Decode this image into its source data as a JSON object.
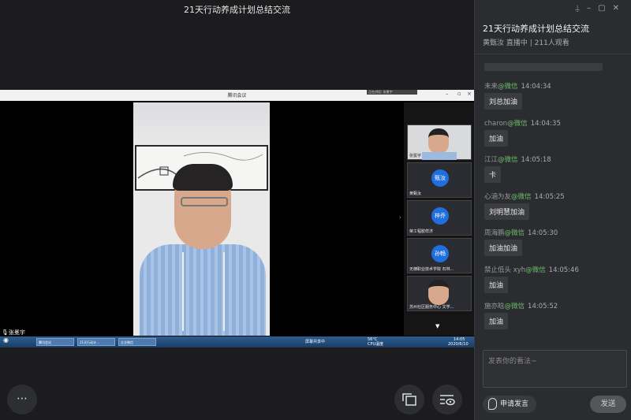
{
  "stage": {
    "title": "21天行动养成计划总结交流",
    "meeting_window_title": "腾讯会议",
    "meeting_status": "正在讲话: 张冕宇",
    "presenter": "张冕宇",
    "thumbnails": [
      {
        "label": "张冕宇",
        "avatar": ""
      },
      {
        "label": "黄甄汝",
        "avatar": "甄汝"
      },
      {
        "label": "荣工程胶样济",
        "avatar": "梓乔"
      },
      {
        "label": "无棣职业技术学院 石林...",
        "avatar": "孙畅"
      },
      {
        "label": "苏州社区服务中心 文学...",
        "avatar": ""
      }
    ],
    "taskbar": {
      "tasks": [
        "腾讯会议",
        "21天行动计...",
        "企业微信"
      ],
      "sharing_label": "屏幕共享中",
      "temperature": "56°C",
      "cpu_label": "CPU温度",
      "time": "14:05",
      "date": "2020/6/10"
    },
    "controls": {
      "more_icon": "more-icon",
      "window_icon": "window-switch-icon",
      "eye_icon": "eye-settings-icon"
    }
  },
  "panel": {
    "title": "21天行动养成计划总结交流",
    "subtitle": "黄甄汝  直播中 | 211人观看",
    "messages": [
      {
        "user": "未来",
        "source": "@微信",
        "time": "14:04:34",
        "text": "刘总加油"
      },
      {
        "user": "charon",
        "source": "@微信",
        "time": "14:04:35",
        "text": "加油"
      },
      {
        "user": "江江",
        "source": "@微信",
        "time": "14:05:18",
        "text": "卡"
      },
      {
        "user": "心涵为友",
        "source": "@微信",
        "time": "14:05:25",
        "text": "刘明慧加油"
      },
      {
        "user": "周海鹏",
        "source": "@微信",
        "time": "14:05:30",
        "text": "加油加油"
      },
      {
        "user": "禁止低头 xyh",
        "source": "@微信",
        "time": "14:05:46",
        "text": "加油"
      },
      {
        "user": "施亦晗",
        "source": "@微信",
        "time": "14:05:52",
        "text": "加油"
      }
    ],
    "input_placeholder": "发表你的看法~",
    "apply_button": "申请发言",
    "send_button": "发送",
    "window_controls": [
      "pin-icon",
      "minimize-icon",
      "maximize-icon",
      "close-icon"
    ]
  },
  "colors": {
    "accent_green": "#6cc16c",
    "panel_bg": "#2b2c2f",
    "stage_bg": "#1c1c1e",
    "avatar_blue": "#1f6fe0"
  }
}
